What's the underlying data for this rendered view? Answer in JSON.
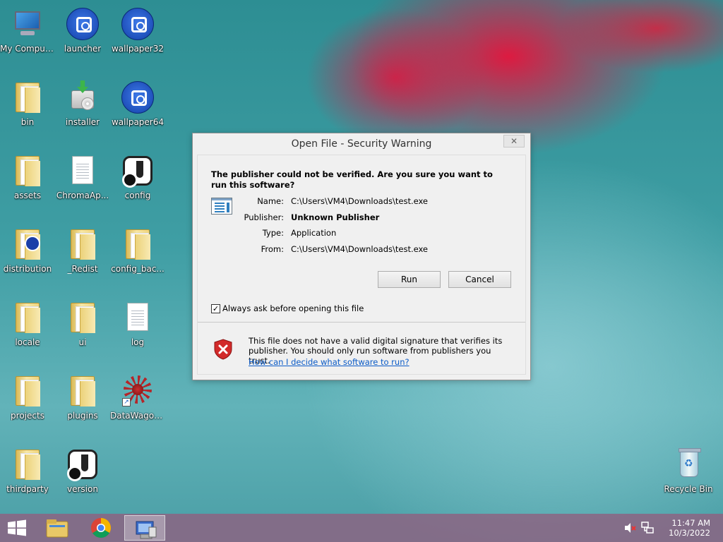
{
  "desktop": {
    "icons": [
      {
        "label": "My Computer"
      },
      {
        "label": "launcher"
      },
      {
        "label": "wallpaper32"
      },
      {
        "label": "bin"
      },
      {
        "label": "installer"
      },
      {
        "label": "wallpaper64"
      },
      {
        "label": "assets"
      },
      {
        "label": "ChromaAp..."
      },
      {
        "label": "config"
      },
      {
        "label": "distribution"
      },
      {
        "label": "_Redist"
      },
      {
        "label": "config_bac..."
      },
      {
        "label": "locale"
      },
      {
        "label": "ui"
      },
      {
        "label": "log"
      },
      {
        "label": "projects"
      },
      {
        "label": "plugins"
      },
      {
        "label": "DataWagon..."
      },
      {
        "label": "thirdparty"
      },
      {
        "label": "version"
      },
      {
        "label": "Recycle Bin"
      }
    ]
  },
  "dialog": {
    "title": "Open File - Security Warning",
    "close_label": "✕",
    "headline": "The publisher could not be verified.  Are you sure you want to run this software?",
    "fields": {
      "name_label": "Name:",
      "name_value": "C:\\Users\\VM4\\Downloads\\test.exe",
      "publisher_label": "Publisher:",
      "publisher_value": "Unknown Publisher",
      "type_label": "Type:",
      "type_value": "Application",
      "from_label": "From:",
      "from_value": "C:\\Users\\VM4\\Downloads\\test.exe"
    },
    "run_label": "Run",
    "cancel_label": "Cancel",
    "checkbox_label": "Always ask before opening this file",
    "checkbox_checked": true,
    "checkbox_mark": "✓",
    "warning_text": "This file does not have a valid digital signature that verifies its publisher.  You should only run software from publishers you trust.",
    "warning_link": "How can I decide what software to run?"
  },
  "taskbar": {
    "clock_time": "11:47 AM",
    "clock_date": "10/3/2022"
  },
  "colors": {
    "link": "#0b5bc7",
    "warning_red": "#d22a2a"
  }
}
